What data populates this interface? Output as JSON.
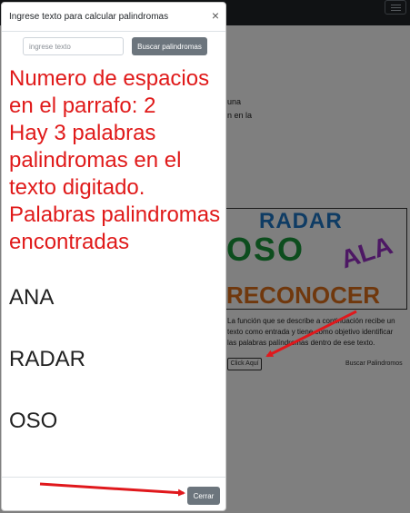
{
  "background": {
    "paragraph_lines": [
      "una",
      "n en la"
    ],
    "card_image_words": [
      "RADAR",
      "OSO",
      "ALA",
      "RECONOCER"
    ],
    "card_description": "La función que se describe a continuación recibe un texto como entrada y tiene como objetivo identificar las palabras palíndromas dentro de ese texto.",
    "click_label": "Click Aquí",
    "search_link": "Buscar Palindromos"
  },
  "modal": {
    "title": "Ingrese texto para calcular palindromas",
    "close_symbol": "×",
    "search": {
      "placeholder": "ingrese texto",
      "button_label": "Buscar palindromas"
    },
    "results": {
      "spaces_text": "Numero de espacios en el parrafo: 2",
      "count_text": "Hay 3 palabras palindromas en el texto digitado.",
      "found_heading": "Palabras palindromas encontradas",
      "found_words": [
        "ANA",
        "RADAR",
        "OSO"
      ]
    },
    "footer": {
      "close_label": "Cerrar"
    }
  },
  "colors": {
    "result_red": "#e01a1a",
    "button_gray": "#6c757d",
    "annotation_red": "#e0181c"
  }
}
